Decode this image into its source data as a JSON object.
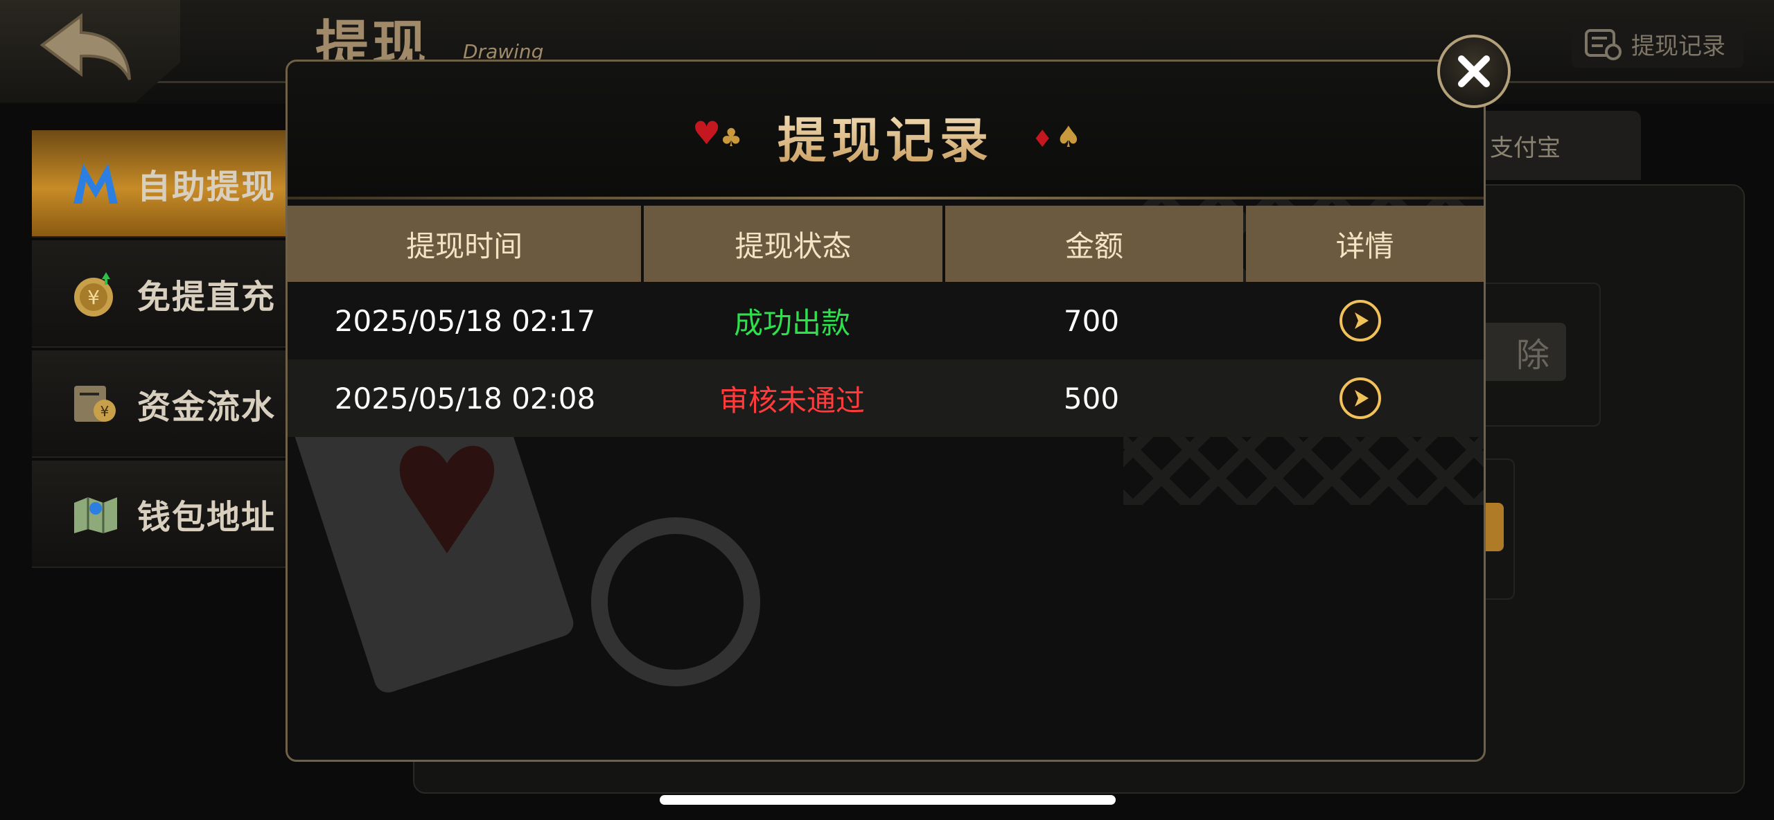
{
  "header": {
    "title": "提现",
    "subtitle": "Drawing",
    "records_button_label": "提现记录"
  },
  "sidebar": {
    "items": [
      {
        "label": "自助提现",
        "icon": "m-logo-icon",
        "active": true
      },
      {
        "label": "免提直充",
        "icon": "yen-coin-icon",
        "active": false
      },
      {
        "label": "资金流水",
        "icon": "money-flow-icon",
        "active": false
      },
      {
        "label": "钱包地址",
        "icon": "map-location-icon",
        "active": false
      }
    ]
  },
  "background_panel": {
    "tab_label": "支付宝",
    "clear_label": "除"
  },
  "modal": {
    "title": "提现记录",
    "columns": [
      "提现时间",
      "提现状态",
      "金额",
      "详情"
    ],
    "rows": [
      {
        "time": "2025/05/18 02:17",
        "status": "成功出款",
        "status_color": "#2ee04b",
        "amount": "700"
      },
      {
        "time": "2025/05/18 02:08",
        "status": "审核未通过",
        "status_color": "#ff3b3b",
        "amount": "500"
      }
    ]
  },
  "colors": {
    "accent_gold": "#c78b27",
    "header_cell": "#6b5a40",
    "success": "#2ee04b",
    "failure": "#ff3b3b"
  }
}
